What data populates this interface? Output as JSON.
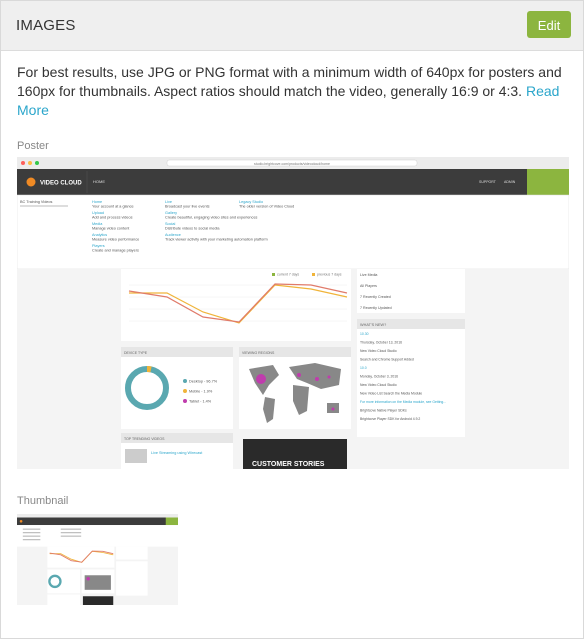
{
  "header": {
    "title": "IMAGES",
    "edit_label": "Edit"
  },
  "description": {
    "text": "For best results, use JPG or PNG format with a minimum width of 640px for posters and 160px for thumbnails. Aspect ratios should match the video, generally 16:9 or 4:3. ",
    "link": "Read More"
  },
  "poster": {
    "label": "Poster",
    "screenshot": {
      "brand": "VIDEO CLOUD",
      "url": "studio.brightcove.com/products/videocloud/home",
      "nav_home": "HOME",
      "nav_support": "SUPPORT",
      "nav_admin": "ADMIN",
      "account_title": "BC Training Videos",
      "menu_col1": [
        {
          "title": "Home",
          "desc": "Your account at a glance"
        },
        {
          "title": "Upload",
          "desc": "Add and process videos"
        },
        {
          "title": "Media",
          "desc": "Manage video content"
        },
        {
          "title": "Analytics",
          "desc": "Measure video performance"
        },
        {
          "title": "Players",
          "desc": "Create and manage players"
        }
      ],
      "menu_col2": [
        {
          "title": "Live",
          "desc": "Broadcast your live events"
        },
        {
          "title": "Gallery",
          "desc": "Create beautiful, engaging video sites and experiences"
        },
        {
          "title": "Social",
          "desc": "Distribute videos to social media"
        },
        {
          "title": "Audience",
          "desc": "Track viewer activity with your marketing automation platform"
        }
      ],
      "menu_col3": [
        {
          "title": "Legacy Studio",
          "desc": "The older version of Video Cloud"
        }
      ],
      "legend_current": "current 7 days",
      "legend_previous": "previous 7 days",
      "side_items": [
        "Live Media",
        "All Players",
        "7 Recently Created",
        "7 Recently Updated"
      ],
      "whats_new": "WHAT'S NEW?",
      "news": [
        "10.30",
        "Thursday, October 13, 2016",
        "New Video Cloud Studio",
        "Search and Chrome Support Added",
        "10.0",
        "Monday, October 3, 2016",
        "New Video Cloud Studio",
        "New Video List Search the Media Module",
        "For more information on the Media module, see Getting...",
        "Brightcove Native Player SDKs",
        "Brightcove Player SDK for Android 4.9.2"
      ],
      "device_type": "DEVICE TYPE",
      "viewing_regions": "VIEWING REGIONS",
      "device_legend": [
        "Desktop - 96.7%",
        "Mobile - 1.9%",
        "Tablet - 1.4%"
      ],
      "top_trending": "TOP TRENDING VIDEOS",
      "trending_title": "Live Streaming using Wirecast",
      "customer_stories": "CUSTOMER STORIES"
    }
  },
  "thumbnail": {
    "label": "Thumbnail"
  },
  "colors": {
    "accent": "#8cb53f",
    "link": "#2ba6cb",
    "header_bg": "#efefef",
    "donut": "#5aa8b0",
    "line_current": "#f0b43a",
    "line_previous": "#e07b6a"
  }
}
